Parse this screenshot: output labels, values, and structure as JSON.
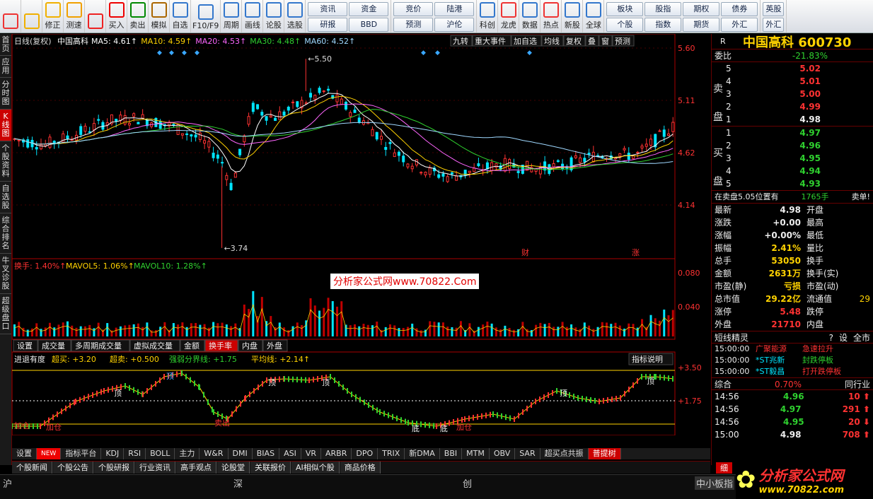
{
  "toolbar": {
    "buttons": [
      {
        "label": "",
        "icon": "grid-icon",
        "color": "#e33"
      },
      {
        "label": "",
        "icon": "back-arrow-icon",
        "color": "#f0b000"
      },
      {
        "label": "修正",
        "icon": "arrow-updown-icon",
        "color": "#f0b000"
      },
      {
        "label": "测速",
        "icon": "clock-icon",
        "color": "#f0a000"
      },
      {
        "label": "",
        "icon": "stop-icon",
        "color": "#e22"
      },
      {
        "label": "买入",
        "icon": "buy-icon",
        "color": "#e00"
      },
      {
        "label": "卖出",
        "icon": "sell-icon",
        "color": "#080"
      },
      {
        "label": "模拟",
        "icon": "hammer-icon",
        "color": "#a60"
      },
      {
        "label": "自选",
        "icon": "folder-icon",
        "color": "#37c"
      },
      {
        "label": "F10/F9",
        "icon": "f10-icon",
        "color": "#37c"
      },
      {
        "label": "周期",
        "icon": "cycle-icon",
        "color": "#37c"
      },
      {
        "label": "画线",
        "icon": "pencil-icon",
        "color": "#37c"
      },
      {
        "label": "论股",
        "icon": "discuss-icon",
        "color": "#37c"
      },
      {
        "label": "选股",
        "icon": "select-icon",
        "color": "#37c"
      }
    ],
    "grid1": [
      "资讯",
      "资金",
      "研报",
      "BBD"
    ],
    "grid2": [
      "竞价",
      "陆港",
      "预测",
      "沪伦"
    ],
    "buttons2": [
      {
        "label": "科创",
        "icon": "chart-icon",
        "color": "#37c"
      },
      {
        "label": "龙虎",
        "icon": "dragon-icon",
        "color": "#e33"
      },
      {
        "label": "数据",
        "icon": "pe-icon",
        "color": "#37c"
      },
      {
        "label": "热点",
        "icon": "fire-icon",
        "color": "#e33"
      },
      {
        "label": "新股",
        "icon": "ipo-icon",
        "color": "#37c"
      },
      {
        "label": "全球",
        "icon": "globe-icon",
        "color": "#37c"
      }
    ],
    "grid3": [
      "板块",
      "股指",
      "期权",
      "债券",
      "个股",
      "指数",
      "期货",
      "外汇"
    ],
    "grid3_extra": [
      "英股",
      "外汇"
    ]
  },
  "lefttabs": [
    "首页",
    "应用",
    "分时图",
    "K线图",
    "个股资料",
    "自选股",
    "综合排名",
    "牛叉诊股",
    "超级盘口"
  ],
  "kline": {
    "title": "日线(复权)",
    "name": "中国高科",
    "ma": [
      {
        "l": "MA5: 4.61",
        "c": "#ffffff"
      },
      {
        "l": "MA10: 4.59",
        "c": "#ffd200"
      },
      {
        "l": "MA20: 4.53",
        "c": "#ff66ff"
      },
      {
        "l": "MA30: 4.48",
        "c": "#2fd12f"
      },
      {
        "l": "MA60: 4.52",
        "c": "#9fd8ff"
      }
    ],
    "topbtns": [
      "九转",
      "重大事件",
      "加自选",
      "均线",
      "复权",
      "叠",
      "窗",
      "预测"
    ],
    "yticks": [
      "5.60",
      "5.11",
      "4.62",
      "4.14"
    ],
    "hi": "5.50",
    "lo": "3.74",
    "cai": "财",
    "zhang": "涨"
  },
  "vol": {
    "l1": "换手: 1.40%",
    "l2": "MAVOL5: 1.06%",
    "l3": "MAVOL10: 1.28%",
    "yticks": [
      "0.080",
      "0.040"
    ],
    "tabs": [
      "设置",
      "成交量",
      "多周期成交量",
      "虚拟成交量",
      "金额",
      "换手率",
      "内盘",
      "外盘"
    ]
  },
  "ind": {
    "title": "进退有度",
    "t1": "超买: +3.20",
    "t2": "超卖: +0.500",
    "t3": "强弱分界线: +1.75",
    "t4": "平均线: +2.14",
    "btn": "指标说明",
    "yticks": [
      "+3.50",
      "+1.75"
    ],
    "labels": [
      "加仓",
      "加仓",
      "顶",
      "顶",
      "顶",
      "顶",
      "卖出",
      "顶",
      "顶",
      "底",
      "底",
      "加仓"
    ]
  },
  "xaxis": [
    "11",
    "12",
    "01",
    "02",
    "03",
    "04",
    "05",
    "06"
  ],
  "btabs": [
    "设置",
    "NEW",
    "指标平台",
    "KDJ",
    "RSI",
    "BOLL",
    "主力",
    "W&R",
    "DMI",
    "BIAS",
    "ASI",
    "VR",
    "ARBR",
    "DPO",
    "TRIX",
    "新DMA",
    "BBI",
    "MTM",
    "OBV",
    "SAR",
    "超买点共振",
    "普提树"
  ],
  "news": [
    "个股新闻",
    "个股公告",
    "个股研报",
    "行业资讯",
    "高手观点",
    "论股堂",
    "关联报价",
    "AI相似个股",
    "商品价格"
  ],
  "watermark": "分析家公式网www.70822.Com",
  "right": {
    "code": "中国高科 600730",
    "flag": "R",
    "weibi_l": "委比",
    "weibi": "-21.83%",
    "sells": [
      {
        "n": "5",
        "p": "5.02"
      },
      {
        "n": "4",
        "p": "5.01"
      },
      {
        "n": "3",
        "p": "5.00"
      },
      {
        "n": "2",
        "p": "4.99"
      },
      {
        "n": "1",
        "p": "4.98"
      }
    ],
    "buys": [
      {
        "n": "1",
        "p": "4.97"
      },
      {
        "n": "2",
        "p": "4.96"
      },
      {
        "n": "3",
        "p": "4.95"
      },
      {
        "n": "4",
        "p": "4.94"
      },
      {
        "n": "5",
        "p": "4.93"
      }
    ],
    "sell_l": "卖盘",
    "buy_l": "买盘",
    "tip1": "在卖盘5.05位置有",
    "tip2": "1765手",
    "tip3": "卖单!",
    "stats": [
      [
        "最新",
        "4.98",
        "开盘",
        ""
      ],
      [
        "涨跌",
        "+0.00",
        "最高",
        ""
      ],
      [
        "涨幅",
        "+0.00%",
        "最低",
        ""
      ],
      [
        "振幅",
        "2.41%",
        "量比",
        ""
      ],
      [
        "总手",
        "53050",
        "换手",
        ""
      ],
      [
        "金额",
        "2631万",
        "换手(实)",
        ""
      ],
      [
        "市盈(静)",
        "亏损",
        "市盈(动)",
        ""
      ],
      [
        "总市值",
        "29.22亿",
        "流通值",
        "29"
      ],
      [
        "涨停",
        "5.48",
        "跌停",
        ""
      ],
      [
        "外盘",
        "21710",
        "内盘",
        ""
      ]
    ],
    "jx": "短线精灵",
    "jx_btns": [
      "?",
      "设",
      "全市"
    ],
    "jxlist": [
      [
        "15:00:00",
        "广聚能源",
        "急速拉升"
      ],
      [
        "15:00:00",
        "*ST兆新",
        "封跌停板"
      ],
      [
        "15:00:00",
        "*ST毅昌",
        "打开跌停板"
      ]
    ],
    "zh": "综合",
    "zhv": "0.70%",
    "tl": "同行业",
    "ticks": [
      [
        "14:56",
        "4.96",
        "10"
      ],
      [
        "14:56",
        "4.97",
        "291"
      ],
      [
        "14:56",
        "4.95",
        "20"
      ],
      [
        "15:00",
        "4.98",
        "708"
      ]
    ],
    "xi": "细"
  },
  "status": {
    "a": "沪",
    "b": "深",
    "c": "创",
    "d": "中小板指"
  },
  "logo": {
    "title": "分析家公式网",
    "url": "www.70822.com"
  }
}
